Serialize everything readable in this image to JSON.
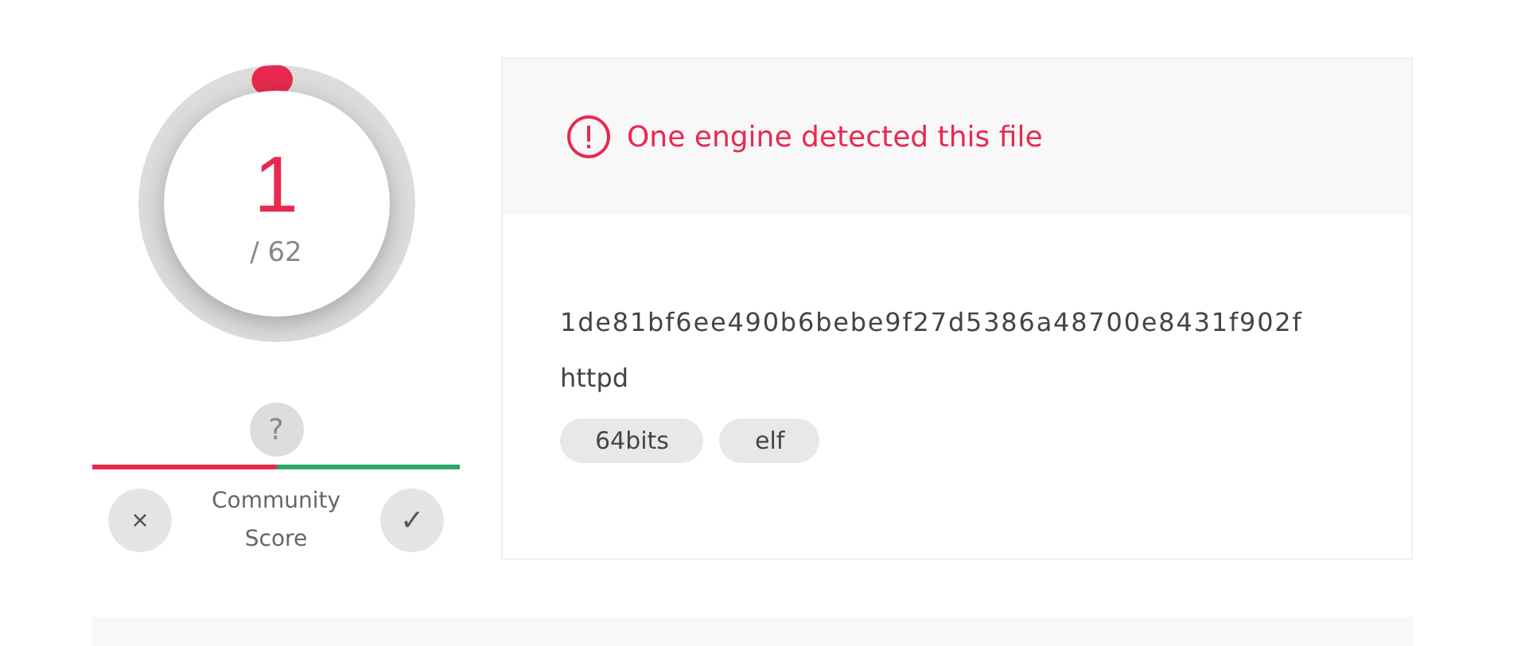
{
  "score": {
    "detections": "1",
    "total": "/ 62",
    "level": 0.016
  },
  "community": {
    "unknown_mark": "?",
    "level": 0.5,
    "label": "Community Score",
    "negative": "×",
    "positive": "✓"
  },
  "alert": {
    "message": "One engine detected this file"
  },
  "file": {
    "hash": "1de81bf6ee490b6bebe9f27d5386a48700e8431f902f",
    "name": "httpd",
    "tags": [
      "64bits",
      "elf"
    ]
  }
}
